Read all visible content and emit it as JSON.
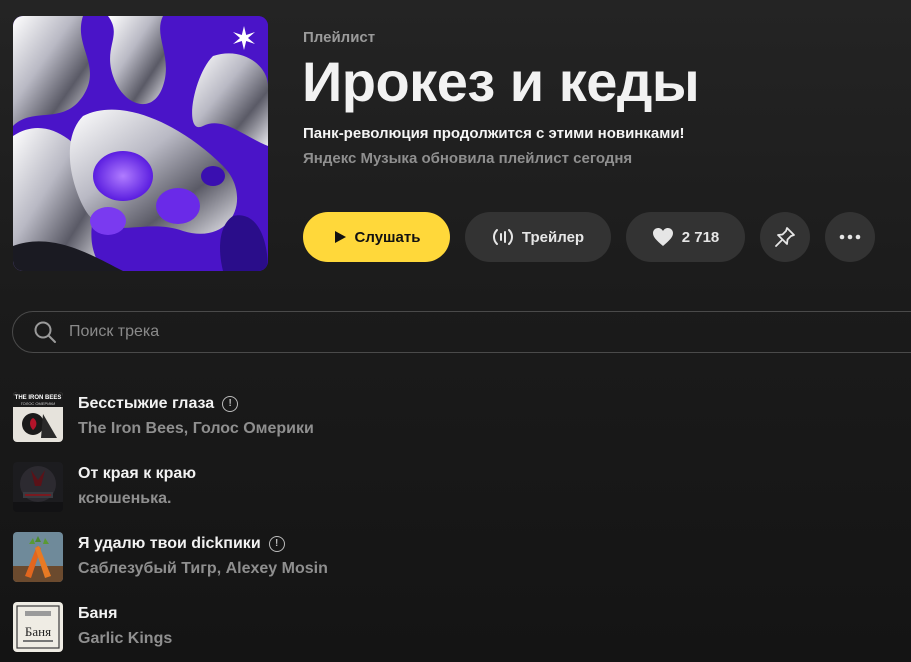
{
  "playlist": {
    "type_label": "Плейлист",
    "title": "Ирокез и кеды",
    "description": "Панк-революция продолжится с этими новинками!",
    "updated": "Яндекс Музыка обновила плейлист сегодня"
  },
  "actions": {
    "play_label": "Слушать",
    "trailer_label": "Трейлер",
    "likes_count": "2 718"
  },
  "search": {
    "placeholder": "Поиск трека"
  },
  "tracks": [
    {
      "title": "Бесстыжие глаза",
      "artist": "The Iron Bees, Голос Омерики",
      "explicit": true,
      "cover_text": "THE IRON BEES",
      "cover_subtext": "ГОЛОС ОМЕРИКИ"
    },
    {
      "title": "От края к краю",
      "artist": "ксюшенька.",
      "explicit": false
    },
    {
      "title": "Я удалю твои dickпики",
      "artist": "Саблезубый Тигр, Alexey Mosin",
      "explicit": true
    },
    {
      "title": "Баня",
      "artist": "Garlic Kings",
      "explicit": false,
      "cover_text": "Баня"
    }
  ],
  "colors": {
    "accent": "#ffd83a",
    "button_bg": "#333333",
    "muted_text": "#8f8f8f"
  },
  "icons": [
    "play-icon",
    "trailer-icon",
    "heart-icon",
    "pin-icon",
    "more-icon",
    "search-icon",
    "explicit-icon",
    "sparkle-icon"
  ]
}
